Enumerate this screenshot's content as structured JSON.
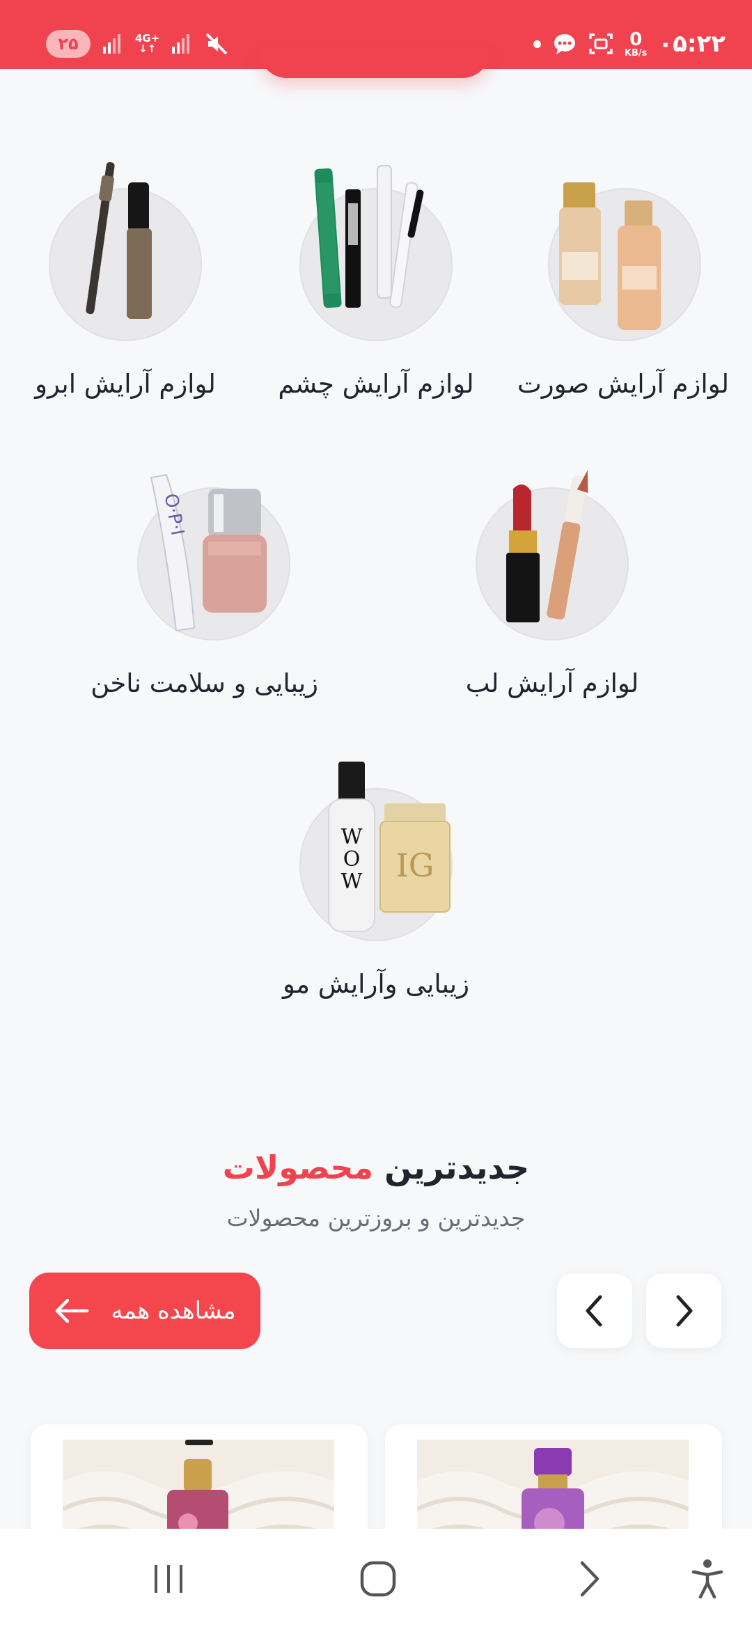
{
  "status_bar": {
    "time": "۰۵:۲۲",
    "net_speed_value": "0",
    "net_speed_unit": "KB/s",
    "network_type": "4G+",
    "battery_level": "۲۵",
    "background_color": "#f0424f"
  },
  "categories": [
    {
      "label": "لوازم آرایش صورت",
      "icon": "foundation-bottles"
    },
    {
      "label": "لوازم آرایش چشم",
      "icon": "mascara-eyeliner"
    },
    {
      "label": "لوازم آرایش ابرو",
      "icon": "brow-pencil"
    },
    {
      "label": "لوازم آرایش لب",
      "icon": "lipstick"
    },
    {
      "label": "زیبایی و سلامت ناخن",
      "icon": "nail-polish"
    },
    {
      "label": "زیبایی وآرایش مو",
      "icon": "hair-spray"
    }
  ],
  "newest_section": {
    "title_part1": "جدیدترین",
    "title_part2": "محصولات",
    "subtitle": "جدیدترین و بروزترین محصولات",
    "view_all_label": "مشاهده همه",
    "accent_color": "#f0424f"
  },
  "bottom_nav": {
    "recents": "recents-icon",
    "home": "home-icon",
    "back": "back-icon",
    "accessibility": "accessibility-icon"
  }
}
